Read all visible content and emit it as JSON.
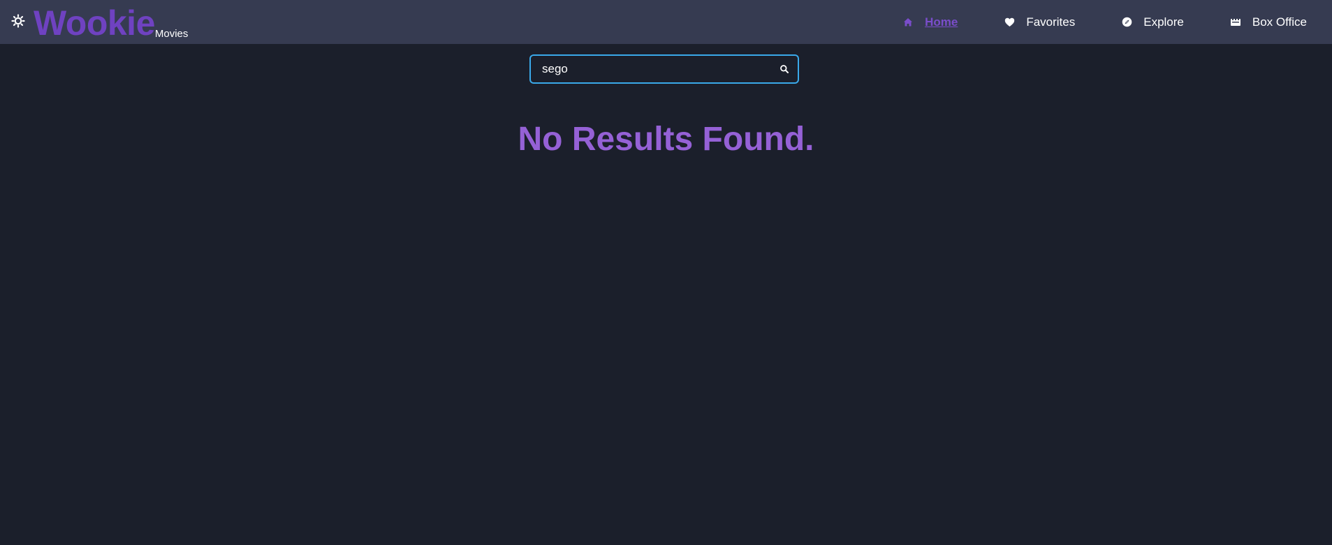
{
  "brand": {
    "name": "Wookie",
    "sub": "Movies"
  },
  "nav": {
    "items": [
      {
        "label": "Home",
        "icon": "home-icon",
        "active": true
      },
      {
        "label": "Favorites",
        "icon": "heart-icon",
        "active": false
      },
      {
        "label": "Explore",
        "icon": "compass-icon",
        "active": false
      },
      {
        "label": "Box Office",
        "icon": "ticket-icon",
        "active": false
      }
    ]
  },
  "search": {
    "value": "sego",
    "placeholder": ""
  },
  "results": {
    "message": "No Results Found."
  },
  "colors": {
    "background": "#1b1f2b",
    "navbar": "#363b51",
    "brand": "#6f42c1",
    "accent": "#9561d6",
    "search_border": "#3aa9ea"
  }
}
